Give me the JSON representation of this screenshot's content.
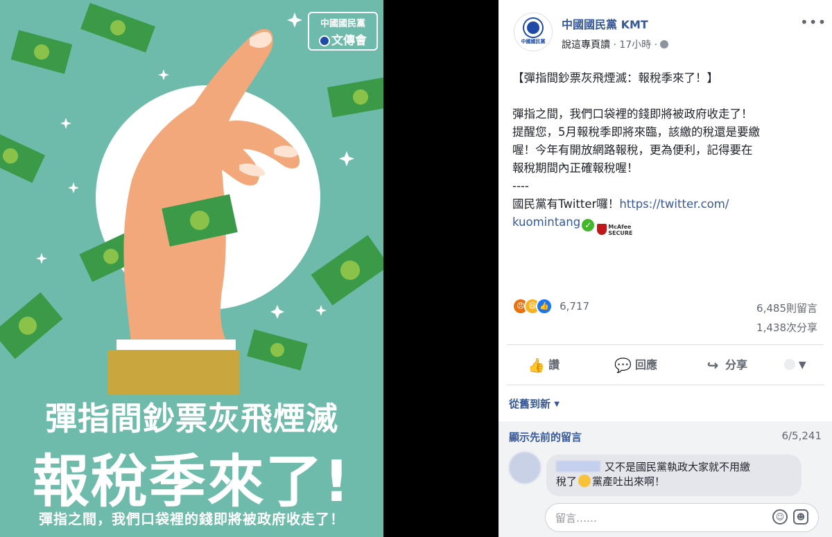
{
  "poster": {
    "badge_line1": "中國國民黨",
    "badge_line2": "文傳會",
    "headline1": "彈指間鈔票灰飛煙滅",
    "headline2": "報稅季來了!",
    "headline3": "彈指之間，我們口袋裡的錢即將被政府收走了！",
    "bg_color": "#6fbbab",
    "money_color": "#3a9a48"
  },
  "post": {
    "page_name": "中國國民黨 KMT",
    "avatar_label": "中國國民黨",
    "editor_text": "說這專頁讀",
    "time": "· 17小時 ·",
    "more": "•••",
    "title_line": "【彈指間鈔票灰飛煙滅：報稅季來了！】",
    "body_lines": [
      "彈指之間，我們口袋裡的錢即將被政府收走了！",
      "提醒您，5月報稅季即將來臨，該繳的稅還是要繳",
      "喔！今年有開放網路報稅，更為便利，記得要在",
      "報稅期間內正確報稅喔！"
    ],
    "separator": "----",
    "twitter_text": "國民黨有Twitter囉！",
    "twitter_link_1": "https://twitter.com/",
    "twitter_link_2": "kuomintang",
    "mcafee_line1": "McAfee",
    "mcafee_line2": "SECURE",
    "reaction_count": "6,717",
    "comments_count": "6,485則留言",
    "shares_count": "1,438次分享",
    "actions": {
      "like": "讚",
      "comment": "回應",
      "share": "分享"
    },
    "sort_label": "從舊到新",
    "prev_comments": "顯示先前的留言",
    "pager": "6/5,241",
    "comment_text_1": "又不是國民黨執政大家就不用繳",
    "comment_text_2a": "稅了",
    "comment_text_2b": "黨產吐出來啊！",
    "reply_placeholder": "留言……",
    "link_color": "#365899"
  }
}
